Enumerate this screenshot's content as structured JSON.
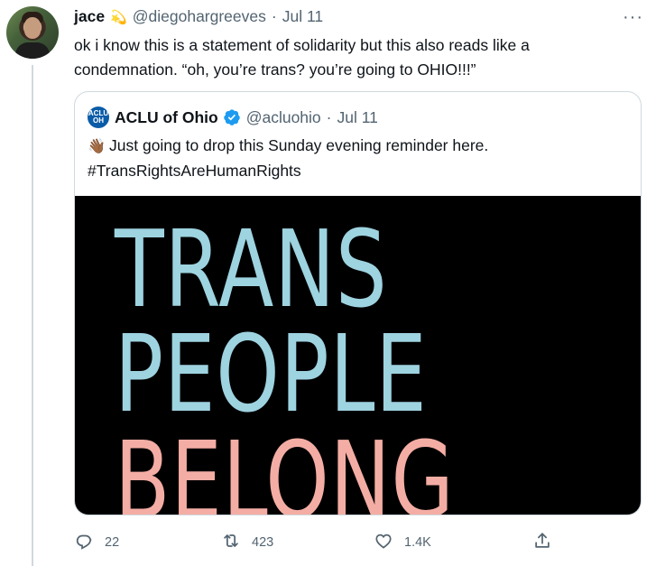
{
  "tweet": {
    "author_name": "jace",
    "author_emoji": "💫",
    "handle": "@diegohargreeves",
    "separator": "·",
    "date": "Jul 11",
    "more_label": "···",
    "text": "ok i know this is a statement of solidarity but this also reads like a condemnation. “oh, you’re trans? you’re going to OHIO!!!”"
  },
  "quoted": {
    "logo_line1": "ACLU",
    "logo_line2": "OH",
    "name": "ACLU of Ohio",
    "handle": "@acluohio",
    "separator": "·",
    "date": "Jul 11",
    "wave_emoji": "👋🏾",
    "text_line1": "Just going to drop this Sunday evening reminder here.",
    "text_line2": "#TransRightsAreHumanRights",
    "image_words": [
      "TRANS",
      "PEOPLE",
      "BELONG"
    ],
    "colors": {
      "blue": "#9ed3e0",
      "pink": "#f4ada4",
      "background": "#000000"
    }
  },
  "actions": {
    "reply_count": "22",
    "retweet_count": "423",
    "like_count": "1.4K",
    "icons": [
      "reply-icon",
      "retweet-icon",
      "like-icon",
      "share-icon"
    ]
  }
}
